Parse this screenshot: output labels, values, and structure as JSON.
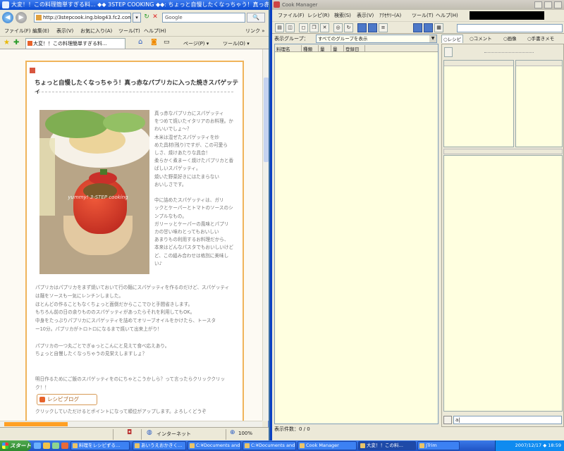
{
  "ie": {
    "title": "大変！！この料理簡単すぎる料... ◆◆ 3STEP COOKING ◆◆: ちょっと自慢したくなっちゃう！真っ赤なパプリカに入...",
    "url": "http://3stepcook.ing.blog43.fc2.com/",
    "search_placeholder": "Google",
    "search_btn": "🔍",
    "menu": [
      "ファイル(F)",
      "編集(E)",
      "表示(V)",
      "お気に入り(A)",
      "ツール(T)",
      "ヘルプ(H)"
    ],
    "links_label": "リンク »",
    "tab_label": "大変！！この料理簡単すぎる料...",
    "cmd": {
      "home": "⌂",
      "page": "ページ(P) ▾",
      "tools": "ツール(O) ▾"
    },
    "status": {
      "zone": "インターネット",
      "zoom": "100%"
    }
  },
  "post": {
    "title": "ちょっと自慢したくなっちゃう！真っ赤なパプリカに入った焼きスパゲッティ",
    "photo_watermark": "yummy! 3-STEP cooking",
    "side_lines": [
      "真っ赤なパプリカにスパゲッティ",
      "をつめて焼いたイタリアのお料理。か",
      "わいいでしょ〜？",
      "木米は混ぜたスパゲッティを炒",
      "めた具材(残り)ですが、この可愛ら",
      "しさ、焼けあたりな具合！",
      "柔らかく煮まーく焼けたパプリカと香",
      "ばしいスパゲッティ。",
      "焼いた野菜好きにはたまらない",
      "おいしさです。",
      "",
      "中に詰めたスパゲッティは、ガリ",
      "ックとケーパーとトマトのソースのシ",
      "ンプルなもの。",
      "ガリーッとケーパーの風味とパプリ",
      "カの甘い味わとってもおいしい",
      "あまりもの利用するお料理だから、",
      "本来はどんなパスタでもおいしいけど",
      "ど、この組み合わせは格別に美味し",
      "い♪"
    ],
    "body_lines": [
      "パプリカはパプリカをまず焼いておいて行の麺にスパゲッティを作るのだけど、スパゲッティ",
      "は麺をソースも一気にレンチンしました。",
      "ほとんどの作ることもなくちょっと面倒だからここでひと手間省きします。",
      "もちろん前の日の余りもののスパゲッティがあったらそれを利用してもOK。",
      "中身をたっぷりパプリカにスパゲッティを詰めてオリーブオイルをかけたら、トースタ",
      "ー10分。パプリカがトロトロになるまで焼いて出来上がり！",
      "",
      "パプリカの一つ丸ごとでぎゅっとこんにと見えて食べ応えあり。",
      "ちょっと自慢したくなっちゃうの見栄えしますしょ？",
      "",
      "",
      "明日作るためにご飯のスパゲッティをのにちゃとこうかしら？って言ったらクリッククリッ",
      "ク！！"
    ],
    "recipe_btn": "レシピブログ",
    "footer_line": "クリックしていただけるとポイントになって順位がアップします。よろしくどうぞ"
  },
  "cm": {
    "title": "Cook Manager",
    "menu": [
      "ファイル(F)",
      "レシピ(R)",
      "検索(S)",
      "表示(V)",
      "ｱｸｾｻﾘｰ(A)",
      "ツール(T)",
      "ヘルプ(H)"
    ],
    "group_label": "表示グループ：",
    "group_value": "すべてのグループを表示",
    "columns": [
      "料理名",
      "種類",
      "量",
      "量",
      "登録日"
    ],
    "tabs": [
      "○レシピ",
      "○コメント",
      "○画像",
      "○手書きメモ"
    ],
    "status": "表示件数：0 / 0",
    "input_value": "a|"
  },
  "taskbar": {
    "start": "スタート",
    "tasks": [
      "料理をレシピずる…",
      "あいうえおかきく…",
      "C:¥Documents and",
      "C:¥Documents and",
      "Cook Manager",
      "大変！！この料…",
      "JTrim"
    ],
    "active_index": 5,
    "clock": "2007/12/17 ◆ 18:59"
  }
}
